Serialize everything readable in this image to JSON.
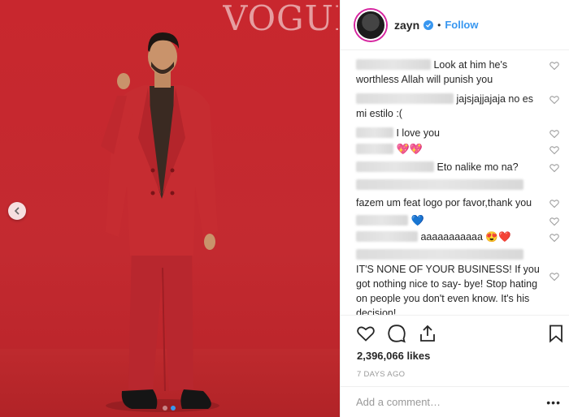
{
  "photo": {
    "magazine_logo": "VOGUE",
    "carousel_dots": 2,
    "active_dot": 2
  },
  "header": {
    "username": "zayn",
    "separator": "•",
    "follow_label": "Follow"
  },
  "comments": [
    {
      "text": "Look at him he's worthless Allah will punish you"
    },
    {
      "text": "jajsjajjajaja no es mi estilo :("
    },
    {
      "text": "I love you"
    },
    {
      "text": "💖💖"
    },
    {
      "text": "Eto nalike mo na?"
    },
    {
      "text": ""
    },
    {
      "text": "fazem um feat logo por favor,thank you"
    },
    {
      "text": "💙"
    },
    {
      "text": "aaaaaaaaaaa 😍❤️"
    },
    {
      "text": "IT'S NONE OF YOUR BUSINESS! If you got nothing nice to say- bye! Stop hating on people you don't even know. It's his decision!"
    }
  ],
  "actions": {
    "like_icon": "heart-outline-icon",
    "comment_icon": "speech-bubble-icon",
    "share_icon": "share-icon",
    "save_icon": "bookmark-icon"
  },
  "likes": "2,396,066 likes",
  "timestamp": "7 DAYS AGO",
  "add_comment": {
    "placeholder": "Add a comment…",
    "more_label": "•••"
  },
  "colors": {
    "accent": "#3897f0",
    "photo_background": "#c8272e",
    "text": "#262626",
    "muted": "#999999"
  }
}
